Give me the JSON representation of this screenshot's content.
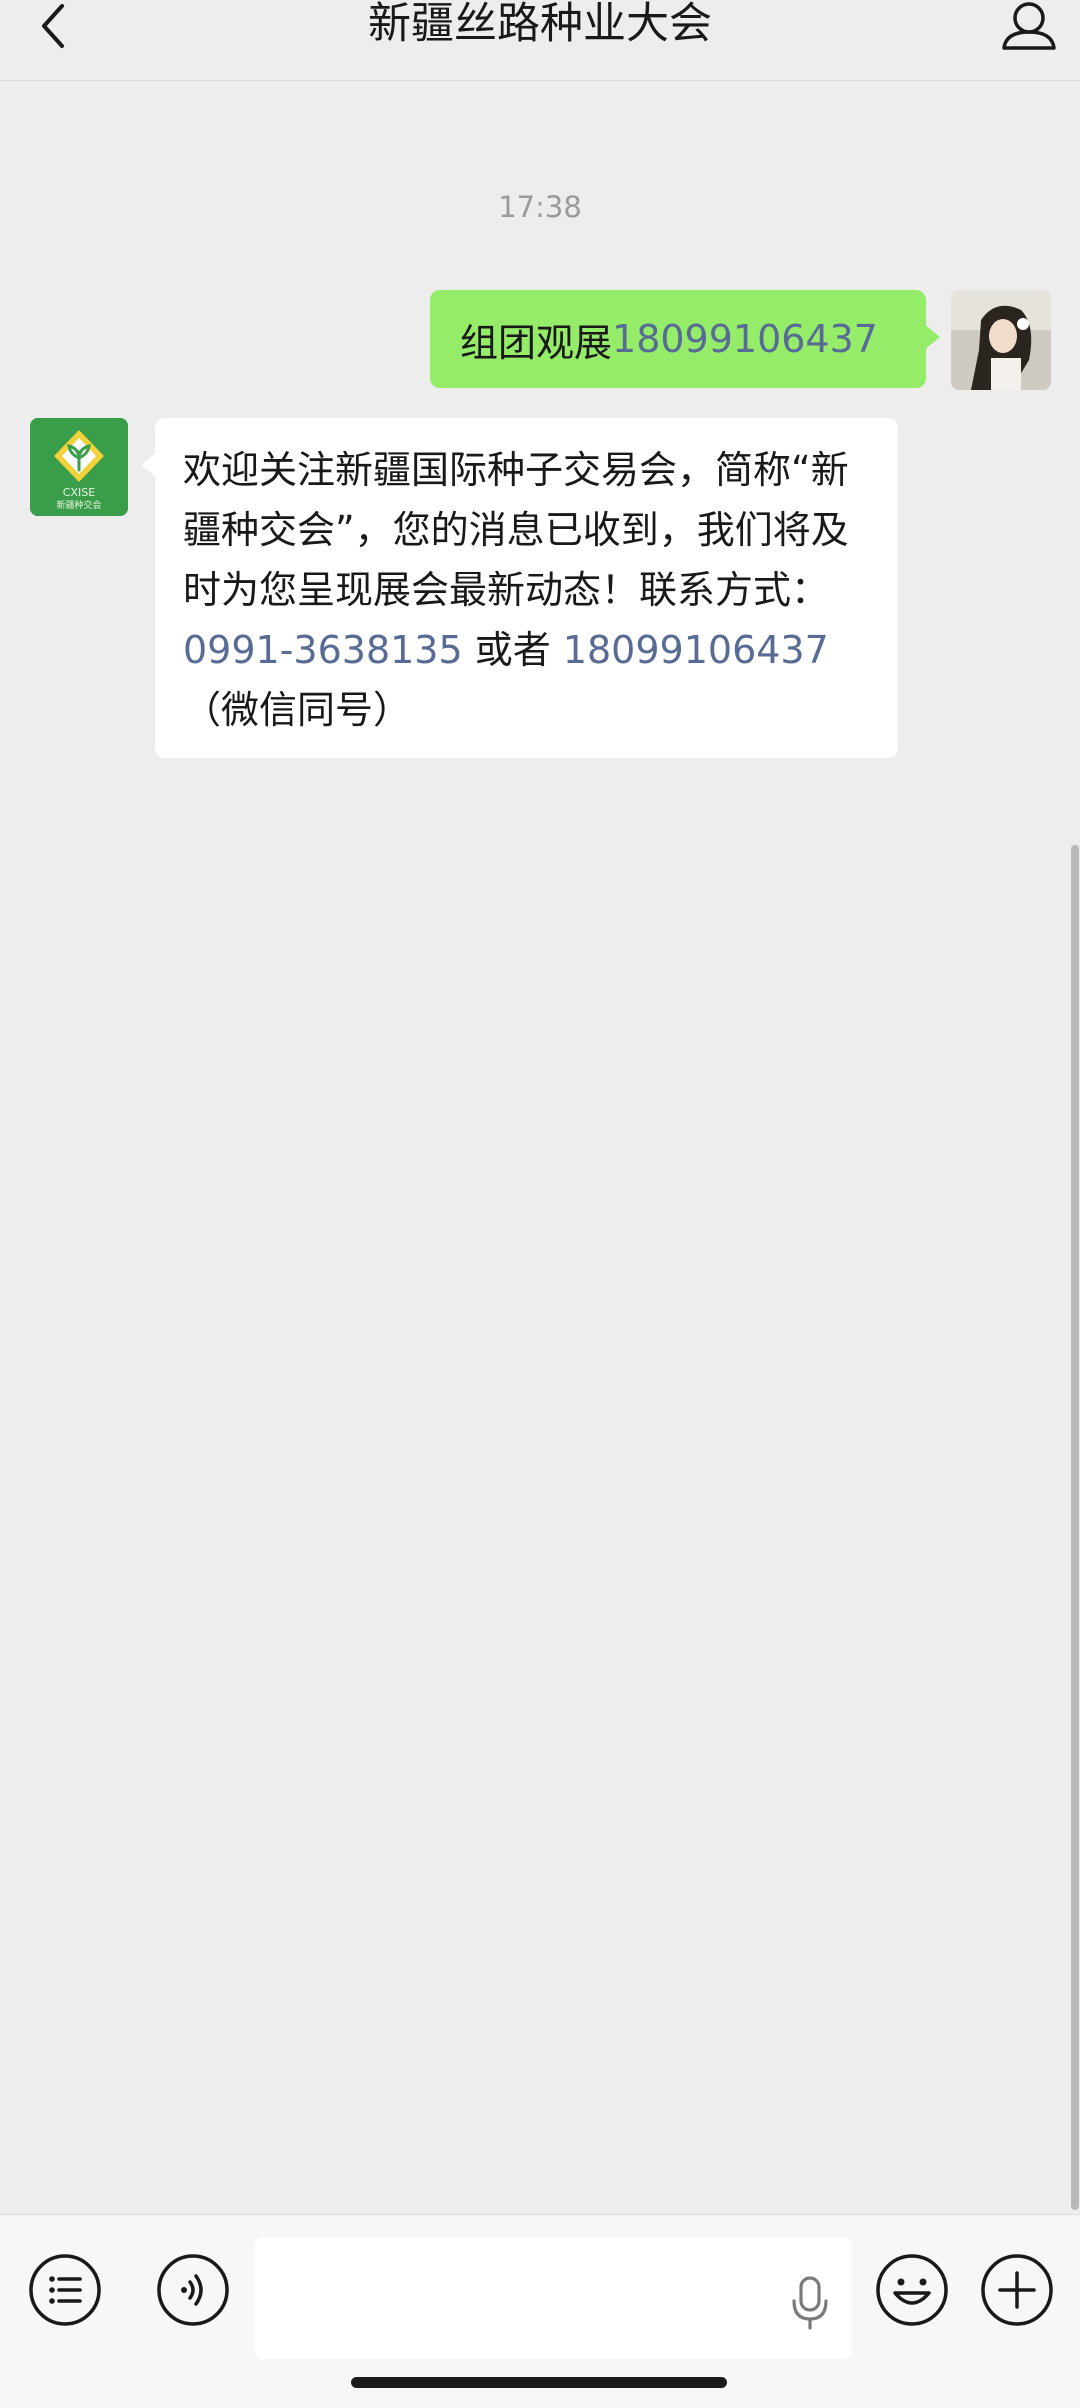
{
  "nav": {
    "title": "新疆丝路种业大会"
  },
  "chat": {
    "timestamp": "17:38",
    "messages": [
      {
        "side": "right",
        "text": "组团观展 ",
        "phone": "18099106437"
      },
      {
        "side": "left",
        "sender_logo_text": "CXISE",
        "sender_logo_subtext": "新疆种交会",
        "text_before": "欢迎关注新疆国际种子交易会，简称“新疆种交会”，您的消息已收到，我们将及时为您呈现展会最新动态！联系方式：",
        "phone1": "0991-3638135",
        "text_middle": " 或者 ",
        "phone2": "18099106437",
        "text_after": "（微信同号）"
      }
    ]
  },
  "input_bar": {
    "text_value": ""
  },
  "colors": {
    "sent_bubble": "#95ec69",
    "received_bubble": "#ffffff",
    "link": "#576b95",
    "background": "#ededed"
  }
}
